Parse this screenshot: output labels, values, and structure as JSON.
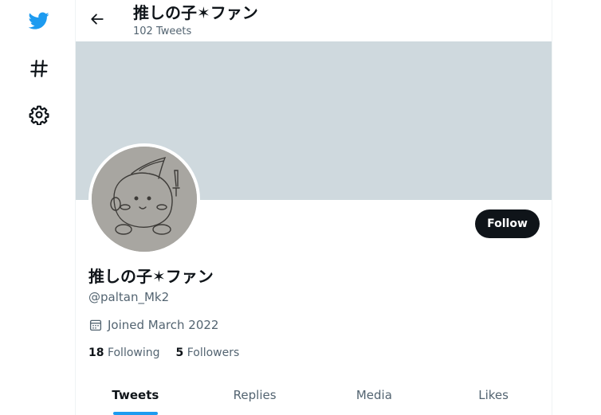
{
  "nav": {
    "items": [
      {
        "icon": "twitter-bird-icon",
        "color": "#1d9bf0"
      },
      {
        "icon": "hashtag-icon"
      },
      {
        "icon": "gear-icon"
      }
    ]
  },
  "header": {
    "title": "推しの子✶ファン",
    "subtitle": "102 Tweets"
  },
  "profile": {
    "banner_color": "#cfd9de",
    "display_name": "推しの子✶ファン",
    "handle": "@paltan_Mk2",
    "joined": "Joined March 2022",
    "following_count": "18",
    "following_label": "Following",
    "followers_count": "5",
    "followers_label": "Followers",
    "follow_button": "Follow"
  },
  "tabs": [
    {
      "label": "Tweets",
      "active": true
    },
    {
      "label": "Replies",
      "active": false
    },
    {
      "label": "Media",
      "active": false
    },
    {
      "label": "Likes",
      "active": false
    }
  ],
  "colors": {
    "accent": "#1d9bf0",
    "text_primary": "#0f1419",
    "text_secondary": "#536471"
  }
}
